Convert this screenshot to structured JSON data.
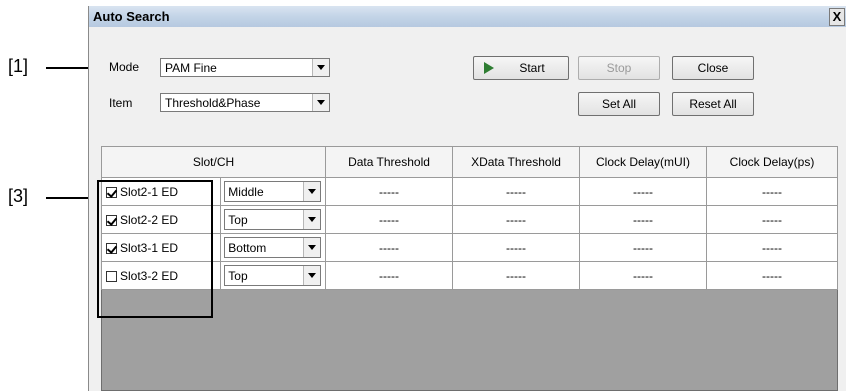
{
  "annotations": {
    "callout1": "[1]",
    "callout3": "[3]"
  },
  "window": {
    "title": "Auto Search",
    "close_glyph": "X"
  },
  "controls": {
    "mode_label": "Mode",
    "mode_value": "PAM Fine",
    "item_label": "Item",
    "item_value": "Threshold&Phase"
  },
  "buttons": {
    "start": "Start",
    "stop": "Stop",
    "close": "Close",
    "set_all": "Set All",
    "reset_all": "Reset All"
  },
  "table": {
    "headers": [
      "Slot/CH",
      "Data Threshold",
      "XData Threshold",
      "Clock Delay(mUI)",
      "Clock Delay(ps)"
    ],
    "rows": [
      {
        "checked": true,
        "slot": "Slot2-1 ED",
        "position": "Middle",
        "data_threshold": "-----",
        "xdata_threshold": "-----",
        "clock_delay_mui": "-----",
        "clock_delay_ps": "-----"
      },
      {
        "checked": true,
        "slot": "Slot2-2 ED",
        "position": "Top",
        "data_threshold": "-----",
        "xdata_threshold": "-----",
        "clock_delay_mui": "-----",
        "clock_delay_ps": "-----"
      },
      {
        "checked": true,
        "slot": "Slot3-1 ED",
        "position": "Bottom",
        "data_threshold": "-----",
        "xdata_threshold": "-----",
        "clock_delay_mui": "-----",
        "clock_delay_ps": "-----"
      },
      {
        "checked": false,
        "slot": "Slot3-2 ED",
        "position": "Top",
        "data_threshold": "-----",
        "xdata_threshold": "-----",
        "clock_delay_mui": "-----",
        "clock_delay_ps": "-----"
      }
    ]
  },
  "colors": {
    "titlebar": "#c3d4e7",
    "dialog_bg": "#f0f0f0",
    "grid_bg": "#a0a0a0",
    "start_icon": "#2e7d32"
  },
  "icons": {
    "start": "play-icon",
    "dropdown": "chevron-down-icon"
  }
}
